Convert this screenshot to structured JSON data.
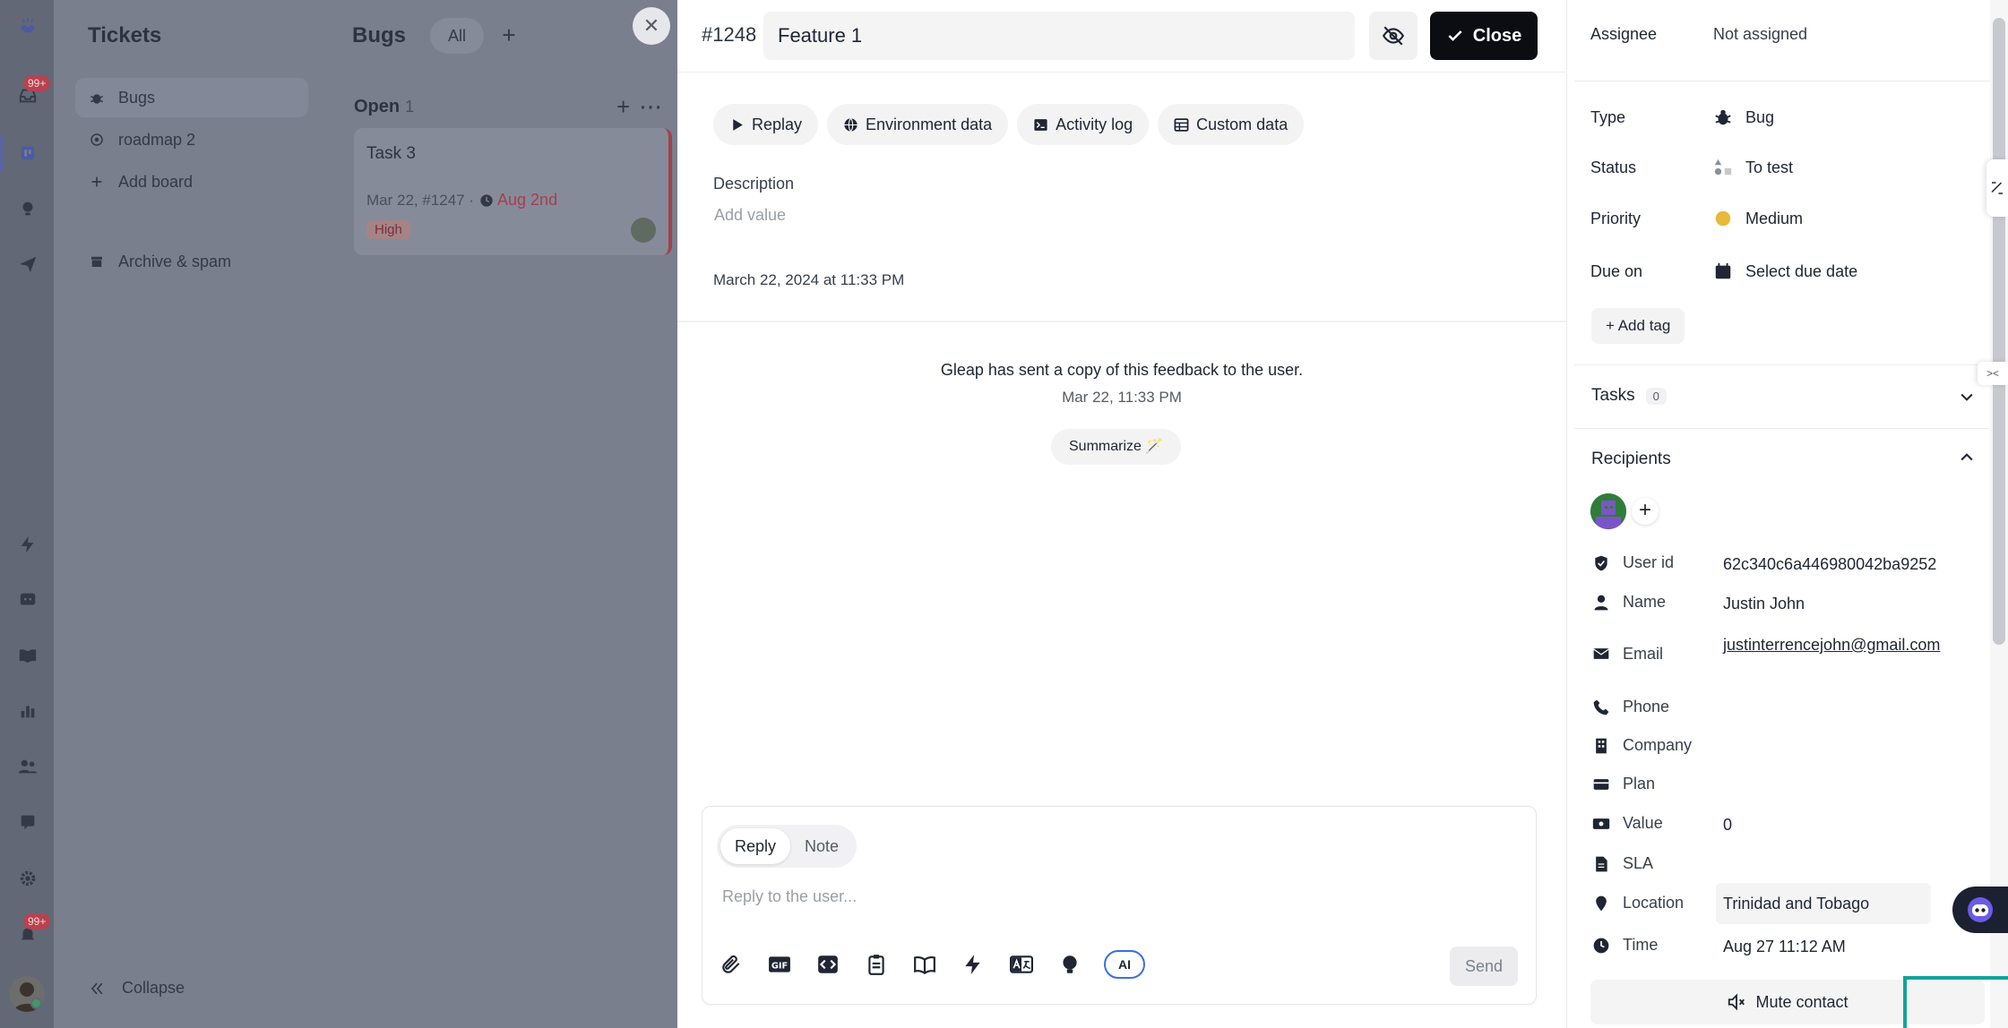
{
  "nav": {
    "title": "Tickets",
    "badge_inbox": "99+",
    "badge_notifications": "99+",
    "items": [
      {
        "label": "Bugs",
        "icon": "bug-icon"
      },
      {
        "label": "roadmap 2",
        "icon": "target-icon"
      },
      {
        "label": "Add board",
        "icon": "plus-icon"
      },
      {
        "label": "Archive & spam",
        "icon": "archive-icon"
      }
    ],
    "collapse": "Collapse"
  },
  "board": {
    "title": "Bugs",
    "filter_all": "All",
    "column": {
      "name": "Open",
      "count": "1"
    },
    "card": {
      "title": "Task 3",
      "meta": "Mar 22, #1247 ·",
      "due": "Aug 2nd",
      "priority": "High"
    }
  },
  "ticket": {
    "id": "#1248",
    "title": "Feature 1",
    "close_label": "Close",
    "tabs": [
      "Replay",
      "Environment data",
      "Activity log",
      "Custom data"
    ],
    "description_label": "Description",
    "description_placeholder": "Add value",
    "created": "March 22, 2024 at 11:33 PM",
    "activity": {
      "text": "Gleap has sent a copy of this feedback to the user.",
      "time": "Mar 22, 11:33 PM"
    },
    "summarize": "Summarize 🪄"
  },
  "composer": {
    "mode_reply": "Reply",
    "mode_note": "Note",
    "placeholder": "Reply to the user...",
    "ai_label": "AI",
    "send": "Send"
  },
  "sidebar": {
    "assignee_label": "Assignee",
    "assignee_value": "Not assigned",
    "type_label": "Type",
    "type_value": "Bug",
    "status_label": "Status",
    "status_value": "To test",
    "priority_label": "Priority",
    "priority_value": "Medium",
    "priority_color": "#e8b93a",
    "due_label": "Due on",
    "due_value": "Select due date",
    "add_tag": "Add tag",
    "tasks_label": "Tasks",
    "tasks_count": "0",
    "recipients_label": "Recipients",
    "attributes": {
      "user_id": {
        "label": "User id",
        "value": "62c340c6a446980042ba9252"
      },
      "name": {
        "label": "Name",
        "value": "Justin John"
      },
      "email": {
        "label": "Email",
        "value": "justinterrencejohn@gmail.com"
      },
      "phone": {
        "label": "Phone",
        "value": ""
      },
      "company": {
        "label": "Company",
        "value": ""
      },
      "plan": {
        "label": "Plan",
        "value": ""
      },
      "value": {
        "label": "Value",
        "value": "0"
      },
      "sla": {
        "label": "SLA",
        "value": ""
      },
      "location": {
        "label": "Location",
        "value": "Trinidad and Tobago"
      },
      "time": {
        "label": "Time",
        "value": "Aug 27 11:12 AM"
      }
    },
    "mute": "Mute contact"
  },
  "colors": {
    "accent_focus": "#14a39a",
    "primary_dark": "#0c0d12",
    "danger": "#a44049"
  }
}
